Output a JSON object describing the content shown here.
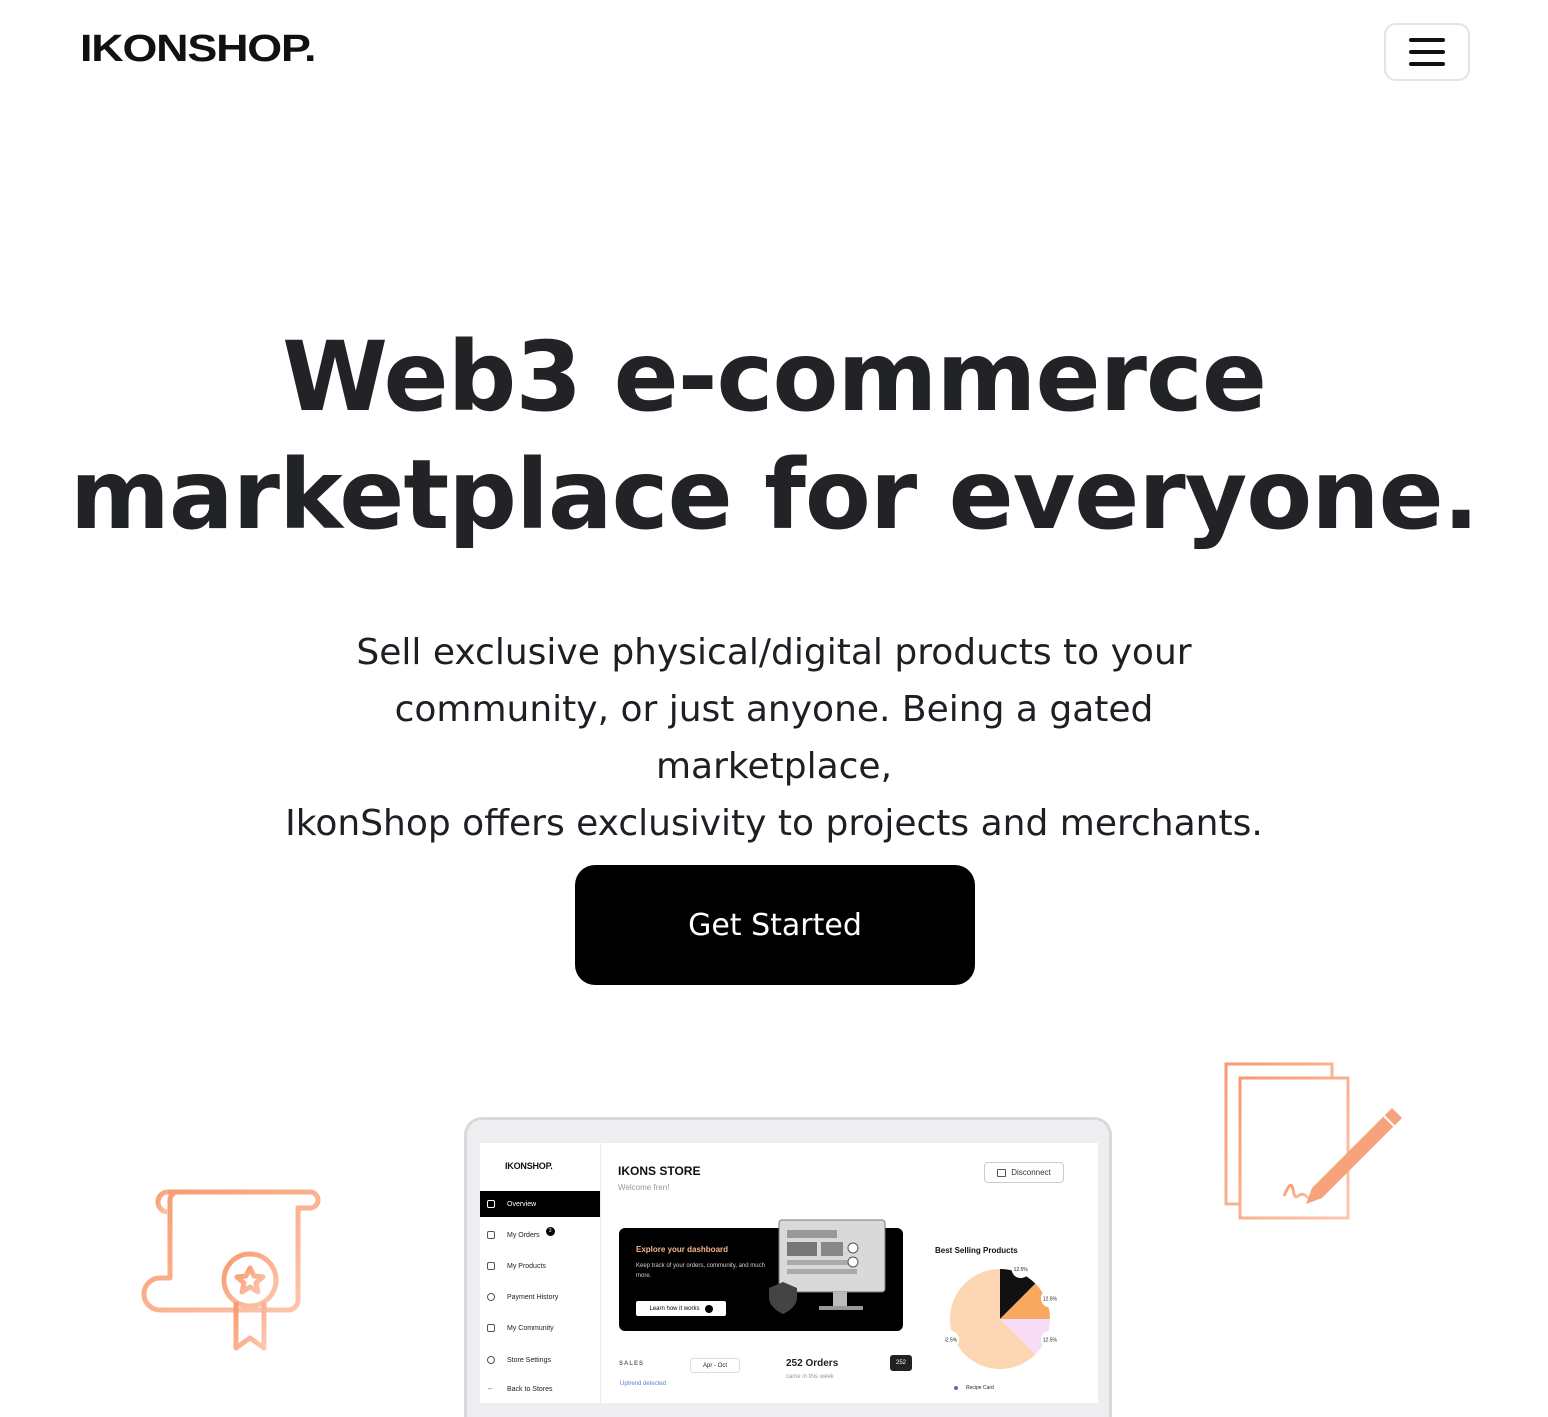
{
  "header": {
    "logo": "IKONSHOP."
  },
  "hero": {
    "title_line1": "Web3 e-commerce",
    "title_line2": "marketplace for everyone.",
    "subtitle_line1": "Sell exclusive physical/digital products to your",
    "subtitle_line2": "community, or just anyone. Being a gated marketplace,",
    "subtitle_line3": "IkonShop offers exclusivity to projects and merchants.",
    "cta": "Get Started"
  },
  "dashboard": {
    "logo": "IKONSHOP.",
    "store_title": "IKONS STORE",
    "welcome": "Welcome fren!",
    "disconnect": "Disconnect",
    "nav": [
      {
        "label": "Overview"
      },
      {
        "label": "My Orders",
        "badge": "3"
      },
      {
        "label": "My Products"
      },
      {
        "label": "Payment History"
      },
      {
        "label": "My Community"
      },
      {
        "label": "Store Settings"
      },
      {
        "label": "Back to Stores"
      }
    ],
    "card": {
      "title": "Explore your dashboard",
      "text": "Keep track of your orders, community, and much more.",
      "button": "Learn how it works"
    },
    "best_selling": "Best Selling Products",
    "pie_labels": [
      "12.5%",
      "12.5%",
      "12.5%",
      "62.5%"
    ],
    "sales_label": "SALES",
    "period": "Apr - Oct",
    "orders": "252 Orders",
    "orders_sub": "came in this week",
    "uptrend": "Uptrend detected",
    "tooltip": "252",
    "legend_item": "Recipe Card"
  },
  "colors": {
    "accent": "#f7a27c",
    "accent_light": "#fbc9ae",
    "text": "#1e1f24"
  },
  "chart_data": {
    "type": "pie",
    "title": "Best Selling Products",
    "labels": [
      "12.5%",
      "12.5%",
      "12.5%",
      "62.5%"
    ],
    "values": [
      12.5,
      12.5,
      12.5,
      62.5
    ]
  }
}
